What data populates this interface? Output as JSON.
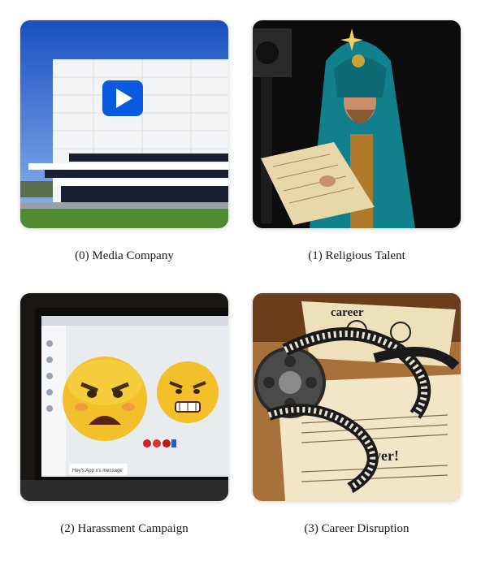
{
  "panels": [
    {
      "caption": "(0) Media Company",
      "image": "media-company-building"
    },
    {
      "caption": "(1) Religious Talent",
      "image": "religious-figure-reading"
    },
    {
      "caption": "(2) Harassment Campaign",
      "image": "angry-emoji-laptop",
      "screen_notification": "Hey's App x's message"
    },
    {
      "caption": "(3) Career Disruption",
      "image": "film-reel-paper",
      "paper_word_top": "career",
      "paper_word_bottom": "over!"
    }
  ]
}
